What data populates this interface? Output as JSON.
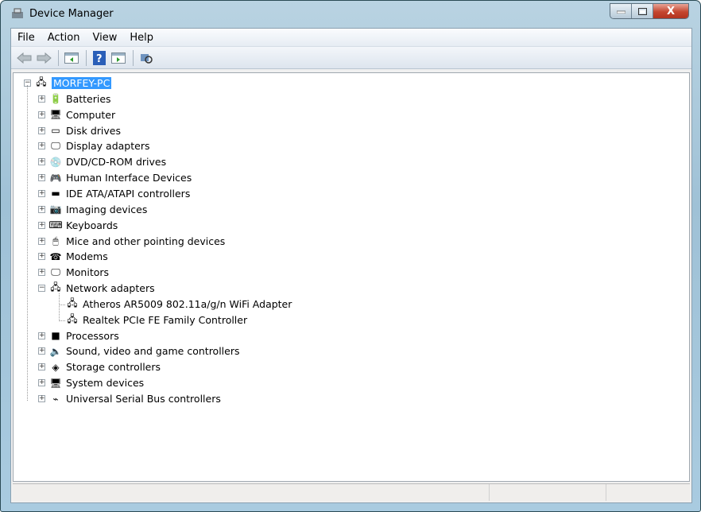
{
  "window": {
    "title": "Device Manager",
    "minimize": "—",
    "maximize": "□",
    "close": "X"
  },
  "menu": [
    "File",
    "Action",
    "View",
    "Help"
  ],
  "toolbar": [
    "back-icon",
    "forward-icon",
    "show-hide-console-tree-icon",
    "help-icon",
    "show-action-pane-icon",
    "scan-hardware-icon"
  ],
  "tree": {
    "root": "MORFEY-PC",
    "items": [
      {
        "label": "Batteries",
        "icon": "battery-icon",
        "glyph": "🔋"
      },
      {
        "label": "Computer",
        "icon": "computer-icon",
        "glyph": "🖥"
      },
      {
        "label": "Disk drives",
        "icon": "disk-drive-icon",
        "glyph": "▭"
      },
      {
        "label": "Display adapters",
        "icon": "display-adapter-icon",
        "glyph": "🖵"
      },
      {
        "label": "DVD/CD-ROM drives",
        "icon": "dvd-icon",
        "glyph": "💿"
      },
      {
        "label": "Human Interface Devices",
        "icon": "hid-icon",
        "glyph": "🎮"
      },
      {
        "label": "IDE ATA/ATAPI controllers",
        "icon": "ide-controller-icon",
        "glyph": "▬"
      },
      {
        "label": "Imaging devices",
        "icon": "camera-icon",
        "glyph": "📷"
      },
      {
        "label": "Keyboards",
        "icon": "keyboard-icon",
        "glyph": "⌨"
      },
      {
        "label": "Mice and other pointing devices",
        "icon": "mouse-icon",
        "glyph": "🖱"
      },
      {
        "label": "Modems",
        "icon": "modem-icon",
        "glyph": "☎"
      },
      {
        "label": "Monitors",
        "icon": "monitor-icon",
        "glyph": "🖵"
      },
      {
        "label": "Network adapters",
        "icon": "network-adapter-icon",
        "glyph": "🖧",
        "expanded": true,
        "children": [
          "Atheros AR5009 802.11a/g/n WiFi Adapter",
          "Realtek PCIe FE Family Controller"
        ]
      },
      {
        "label": "Processors",
        "icon": "processor-icon",
        "glyph": "■"
      },
      {
        "label": "Sound, video and game controllers",
        "icon": "speaker-icon",
        "glyph": "🔈"
      },
      {
        "label": "Storage controllers",
        "icon": "storage-controller-icon",
        "glyph": "◈"
      },
      {
        "label": "System devices",
        "icon": "system-devices-icon",
        "glyph": "🖥"
      },
      {
        "label": "Universal Serial Bus controllers",
        "icon": "usb-icon",
        "glyph": "⌁"
      }
    ]
  }
}
